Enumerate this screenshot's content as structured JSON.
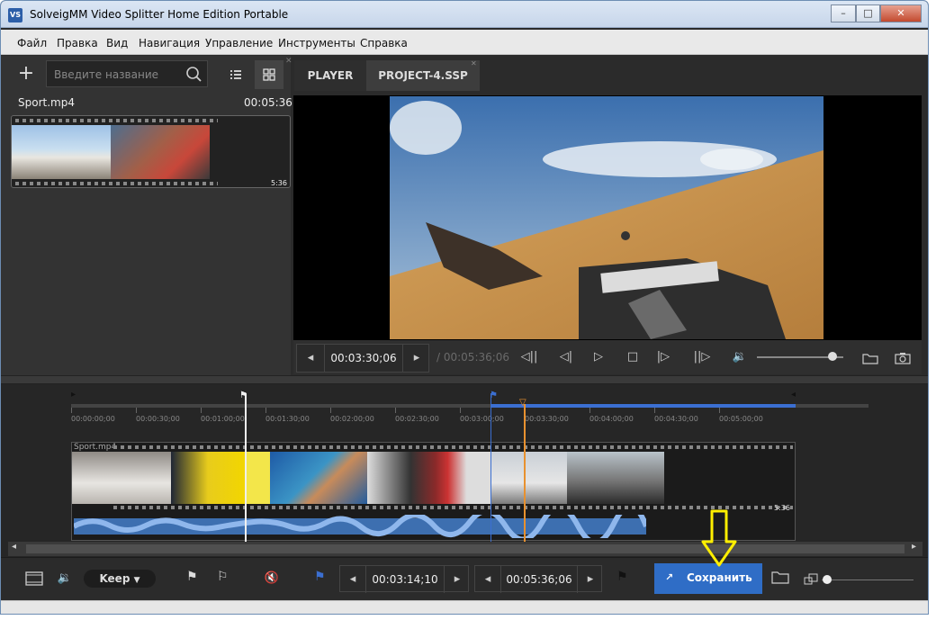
{
  "window": {
    "title": "SolveigMM Video Splitter Home Edition Portable",
    "app_icon": "VS"
  },
  "menu": [
    "Файл",
    "Правка",
    "Вид",
    "Навигация",
    "Управление",
    "Инструменты",
    "Справка"
  ],
  "library": {
    "search_placeholder": "Введите название",
    "file_name": "Sport.mp4",
    "file_duration": "00:05:36",
    "thumb_duration": "5:36"
  },
  "tabs": [
    "PLAYER",
    "PROJECT-4.SSP"
  ],
  "player": {
    "current_time": "00:03:30;06",
    "total_time": "/ 00:05:36;06",
    "volume_level": 0.88
  },
  "ruler": {
    "labels": [
      "00:00:00;00",
      "00:00:30;00",
      "00:01:00;00",
      "00:01:30;00",
      "00:02:00;00",
      "00:02:30;00",
      "00:03:00;00",
      "00:03:30;00",
      "00:04:00;00",
      "00:04:30;00",
      "00:05:00;00"
    ]
  },
  "track": {
    "label": "Sport.mp4",
    "duration": "5:36"
  },
  "bottom": {
    "mode": "Keep",
    "marker_time": "00:03:14;10",
    "end_time": "00:05:36;06",
    "save_label": "Сохранить"
  },
  "colors": {
    "accent": "#2f6dc6",
    "playhead": "#e8912f",
    "selection": "#3b6fd1",
    "annotation": "#ffef00"
  }
}
